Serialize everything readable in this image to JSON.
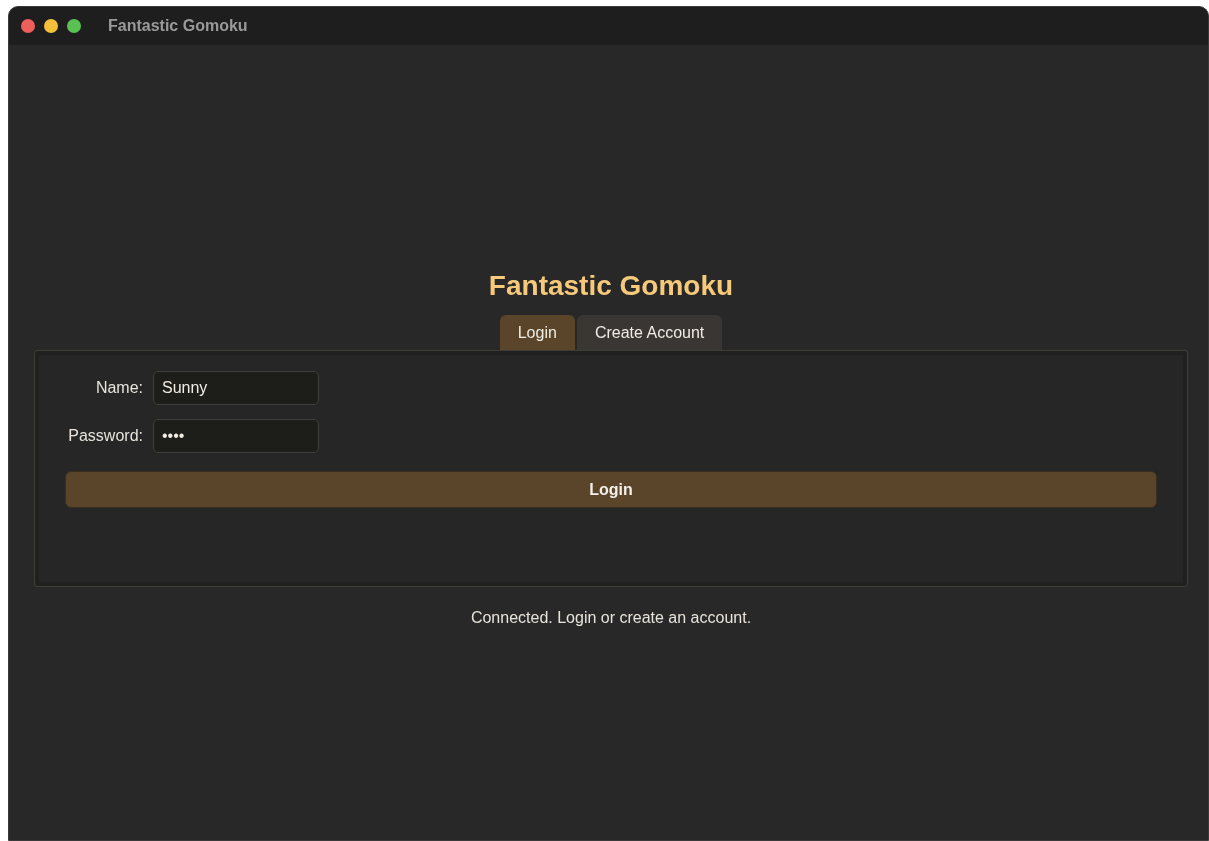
{
  "window": {
    "title": "Fantastic Gomoku"
  },
  "heading": "Fantastic Gomoku",
  "tabs": [
    {
      "label": "Login",
      "selected": true
    },
    {
      "label": "Create Account",
      "selected": false
    }
  ],
  "form": {
    "fields": [
      {
        "label": "Name:",
        "value": "Sunny"
      },
      {
        "label": "Password:",
        "value": "••••"
      }
    ],
    "button": "Login"
  },
  "status": "Connected. Login or create an account."
}
